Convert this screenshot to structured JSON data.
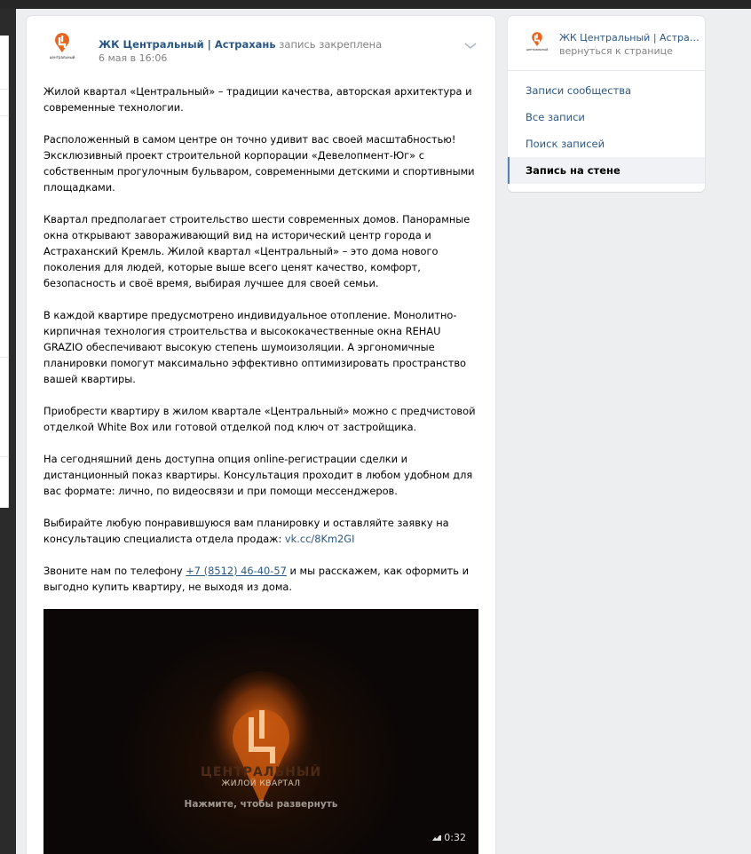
{
  "post": {
    "author_name": "ЖК Центральный | Астрахань",
    "pinned_label": "запись закреплена",
    "date": "6 мая в 16:06",
    "avatar_text": "центральный",
    "paragraphs": [
      "Жилой квартал «Центральный» – традиции качества, авторская архитектура и современные технологии.",
      "Расположенный в самом центре он точно удивит вас своей масштабностью! Эксклюзивный проект строительной корпорации «Девелопмент-Юг» с собственным прогулочным бульваром, современными детскими и спортивными площадками.",
      "Квартал предполагает строительство шести современных домов. Панорамные окна открывают завораживающий вид на исторический центр города и Астраханский Кремль. Жилой квартал «Центральный» – это дома нового поколения для людей, которые выше всего ценят качество, комфорт, безопасность и своё время, выбирая лучшее для своей семьи.",
      "В каждой квартире предусмотрено индивидуальное отопление. Монолитно-кирпичная технология строительства и высококачественные окна REHAU GRAZIO обеспечивают высокую степень шумоизоляции. А эргономичные планировки помогут максимально эффективно оптимизировать пространство вашей квартиры.",
      "Приобрести квартиру в жилом квартале «Центральный» можно с предчистовой отделкой White Box или готовой отделкой под ключ от застройщика.",
      "На сегодняшний день доступна опция online-регистрации сделки и дистанционный показ квартиры. Консультация проходит в любом удобном для вас формате: лично, по видеосвязи и при помощи мессенджеров."
    ],
    "p7_text": "Выбирайте любую понравившуюся вам планировку и оставляйте заявку на консультацию специалиста отдела продаж: ",
    "p7_link": "vk.cc/8Km2GI",
    "p8_before": "Звоните нам по телефону ",
    "p8_phone": "+7 (8512) 46-40-57",
    "p8_after": " и мы расскажем, как оформить и выгодно купить квартиру, не выходя из дома.",
    "video": {
      "brand_title": "ЦЕНТРАЛЬНЫЙ",
      "brand_sub": "ЖИЛОЙ КВАРТАЛ",
      "expand_label": "Нажмите, чтобы развернуть",
      "duration": "0:32"
    }
  },
  "sidebar": {
    "title": "ЖК Центральный | Астрахань",
    "back_label": "вернуться к странице",
    "avatar_text": "центральный",
    "items": [
      {
        "label": "Записи сообщества"
      },
      {
        "label": "Все записи"
      },
      {
        "label": "Поиск записей"
      },
      {
        "label": "Запись на стене"
      }
    ]
  },
  "colors": {
    "link": "#2a5885",
    "muted": "#828282",
    "page_bg": "#edeef0",
    "brand_orange": "#e8641e"
  }
}
